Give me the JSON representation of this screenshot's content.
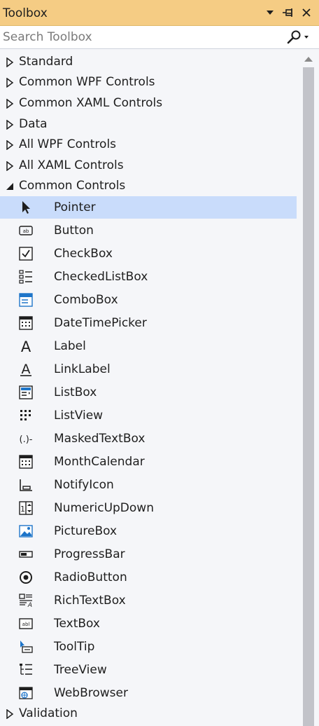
{
  "window": {
    "title": "Toolbox"
  },
  "search": {
    "placeholder": "Search Toolbox",
    "value": ""
  },
  "categories_top": [
    {
      "label": "Standard",
      "expanded": false
    },
    {
      "label": "Common WPF Controls",
      "expanded": false
    },
    {
      "label": "Common XAML Controls",
      "expanded": false
    },
    {
      "label": "Data",
      "expanded": false
    },
    {
      "label": "All WPF Controls",
      "expanded": false
    },
    {
      "label": "All XAML Controls",
      "expanded": false
    },
    {
      "label": "Common Controls",
      "expanded": true
    }
  ],
  "items": [
    {
      "label": "Pointer",
      "icon": "pointer-icon",
      "selected": true
    },
    {
      "label": "Button",
      "icon": "button-icon"
    },
    {
      "label": "CheckBox",
      "icon": "checkbox-icon"
    },
    {
      "label": "CheckedListBox",
      "icon": "checkedlistbox-icon"
    },
    {
      "label": "ComboBox",
      "icon": "combobox-icon"
    },
    {
      "label": "DateTimePicker",
      "icon": "datetimepicker-icon"
    },
    {
      "label": "Label",
      "icon": "label-icon"
    },
    {
      "label": "LinkLabel",
      "icon": "linklabel-icon"
    },
    {
      "label": "ListBox",
      "icon": "listbox-icon"
    },
    {
      "label": "ListView",
      "icon": "listview-icon"
    },
    {
      "label": "MaskedTextBox",
      "icon": "maskedtextbox-icon"
    },
    {
      "label": "MonthCalendar",
      "icon": "monthcalendar-icon"
    },
    {
      "label": "NotifyIcon",
      "icon": "notifyicon-icon"
    },
    {
      "label": "NumericUpDown",
      "icon": "numericupdown-icon"
    },
    {
      "label": "PictureBox",
      "icon": "picturebox-icon"
    },
    {
      "label": "ProgressBar",
      "icon": "progressbar-icon"
    },
    {
      "label": "RadioButton",
      "icon": "radiobutton-icon"
    },
    {
      "label": "RichTextBox",
      "icon": "richtextbox-icon"
    },
    {
      "label": "TextBox",
      "icon": "textbox-icon"
    },
    {
      "label": "ToolTip",
      "icon": "tooltip-icon"
    },
    {
      "label": "TreeView",
      "icon": "treeview-icon"
    },
    {
      "label": "WebBrowser",
      "icon": "webbrowser-icon"
    }
  ],
  "categories_bottom": [
    {
      "label": "Validation",
      "expanded": false
    }
  ],
  "colors": {
    "title_bg": "#f5cc84",
    "selected_bg": "#c9dcfb",
    "panel_bg": "#f5f6f9",
    "icon_blue": "#1e75c9",
    "icon_dark": "#1e1e1e"
  }
}
